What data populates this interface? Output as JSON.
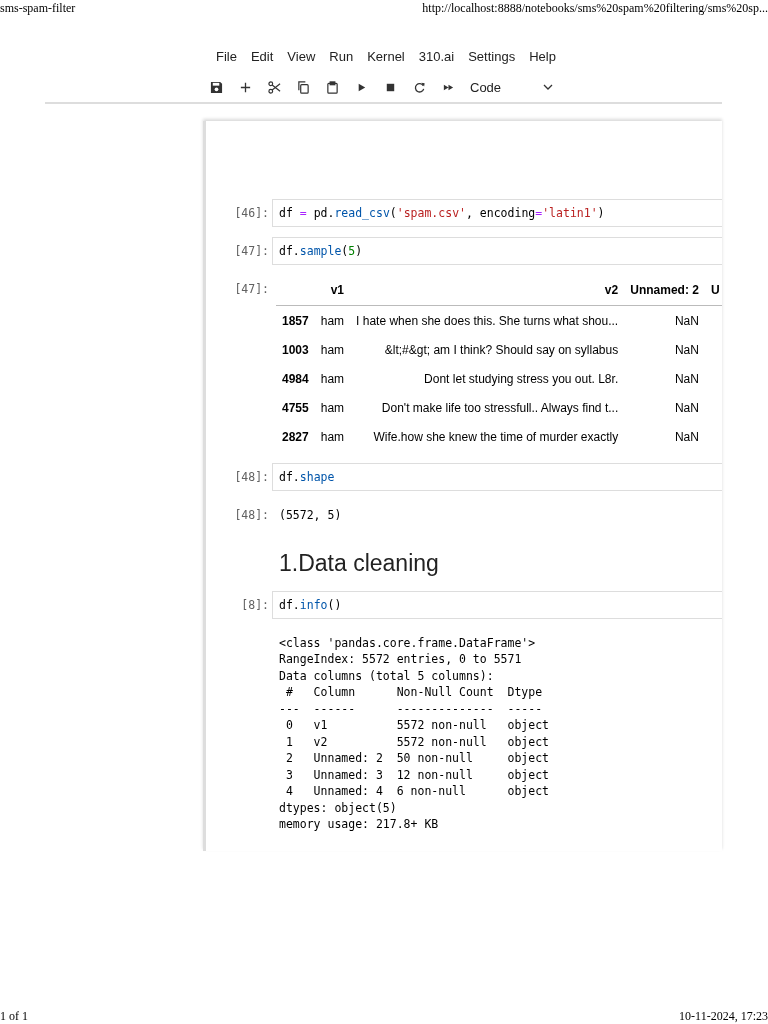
{
  "page_header": {
    "title": "sms-spam-filter",
    "url": "http://localhost:8888/notebooks/sms%20spam%20filtering/sms%20sp..."
  },
  "menu": [
    "File",
    "Edit",
    "View",
    "Run",
    "Kernel",
    "310.ai",
    "Settings",
    "Help"
  ],
  "toolbar": {
    "cell_type": "Code"
  },
  "cells": [
    {
      "kind": "code",
      "prompt": "[46]:",
      "tokens": [
        {
          "text": "df ",
          "kind": "plain"
        },
        {
          "text": "=",
          "kind": "op"
        },
        {
          "text": " pd.",
          "kind": "plain"
        },
        {
          "text": "read_csv",
          "kind": "attr"
        },
        {
          "text": "(",
          "kind": "plain"
        },
        {
          "text": "'spam.csv'",
          "kind": "str"
        },
        {
          "text": ", encoding",
          "kind": "plain"
        },
        {
          "text": "=",
          "kind": "op"
        },
        {
          "text": "'latin1'",
          "kind": "str"
        },
        {
          "text": ")",
          "kind": "plain"
        }
      ]
    },
    {
      "kind": "code",
      "prompt": "[47]:",
      "tokens": [
        {
          "text": "df.",
          "kind": "plain"
        },
        {
          "text": "sample",
          "kind": "attr"
        },
        {
          "text": "(",
          "kind": "plain"
        },
        {
          "text": "5",
          "kind": "num"
        },
        {
          "text": ")",
          "kind": "plain"
        }
      ]
    },
    {
      "kind": "table",
      "prompt": "[47]:",
      "columns": [
        "v1",
        "v2",
        "Unnamed: 2",
        "U"
      ],
      "rows": [
        {
          "index": "1857",
          "cells": [
            "ham",
            "I hate when she does this. She turns what shou...",
            "NaN"
          ]
        },
        {
          "index": "1003",
          "cells": [
            "ham",
            "&lt;#&gt; am I think? Should say on syllabus",
            "NaN"
          ]
        },
        {
          "index": "4984",
          "cells": [
            "ham",
            "Dont let studying stress you out. L8r.",
            "NaN"
          ]
        },
        {
          "index": "4755",
          "cells": [
            "ham",
            "Don't make life too stressfull.. Always find t...",
            "NaN"
          ]
        },
        {
          "index": "2827",
          "cells": [
            "ham",
            "Wife.how she knew the time of murder exactly",
            "NaN"
          ]
        }
      ]
    },
    {
      "kind": "code",
      "prompt": "[48]:",
      "tokens": [
        {
          "text": "df.",
          "kind": "plain"
        },
        {
          "text": "shape",
          "kind": "attr"
        }
      ]
    },
    {
      "kind": "text",
      "prompt": "[48]:",
      "lines": [
        "(5572, 5)"
      ]
    },
    {
      "kind": "heading",
      "text": "1.Data cleaning"
    },
    {
      "kind": "code",
      "prompt": "[8]:",
      "tokens": [
        {
          "text": "df.",
          "kind": "plain"
        },
        {
          "text": "info",
          "kind": "attr"
        },
        {
          "text": "()",
          "kind": "plain"
        }
      ]
    },
    {
      "kind": "text",
      "lines": [
        "<class 'pandas.core.frame.DataFrame'>",
        "RangeIndex: 5572 entries, 0 to 5571",
        "Data columns (total 5 columns):",
        " #   Column      Non-Null Count  Dtype ",
        "---  ------      --------------  ----- ",
        " 0   v1          5572 non-null   object",
        " 1   v2          5572 non-null   object",
        " 2   Unnamed: 2  50 non-null     object",
        " 3   Unnamed: 3  12 non-null     object",
        " 4   Unnamed: 4  6 non-null      object",
        "dtypes: object(5)",
        "memory usage: 217.8+ KB"
      ]
    }
  ],
  "page_footer": {
    "page": "1 of 1",
    "date": "10-11-2024, 17:23"
  }
}
